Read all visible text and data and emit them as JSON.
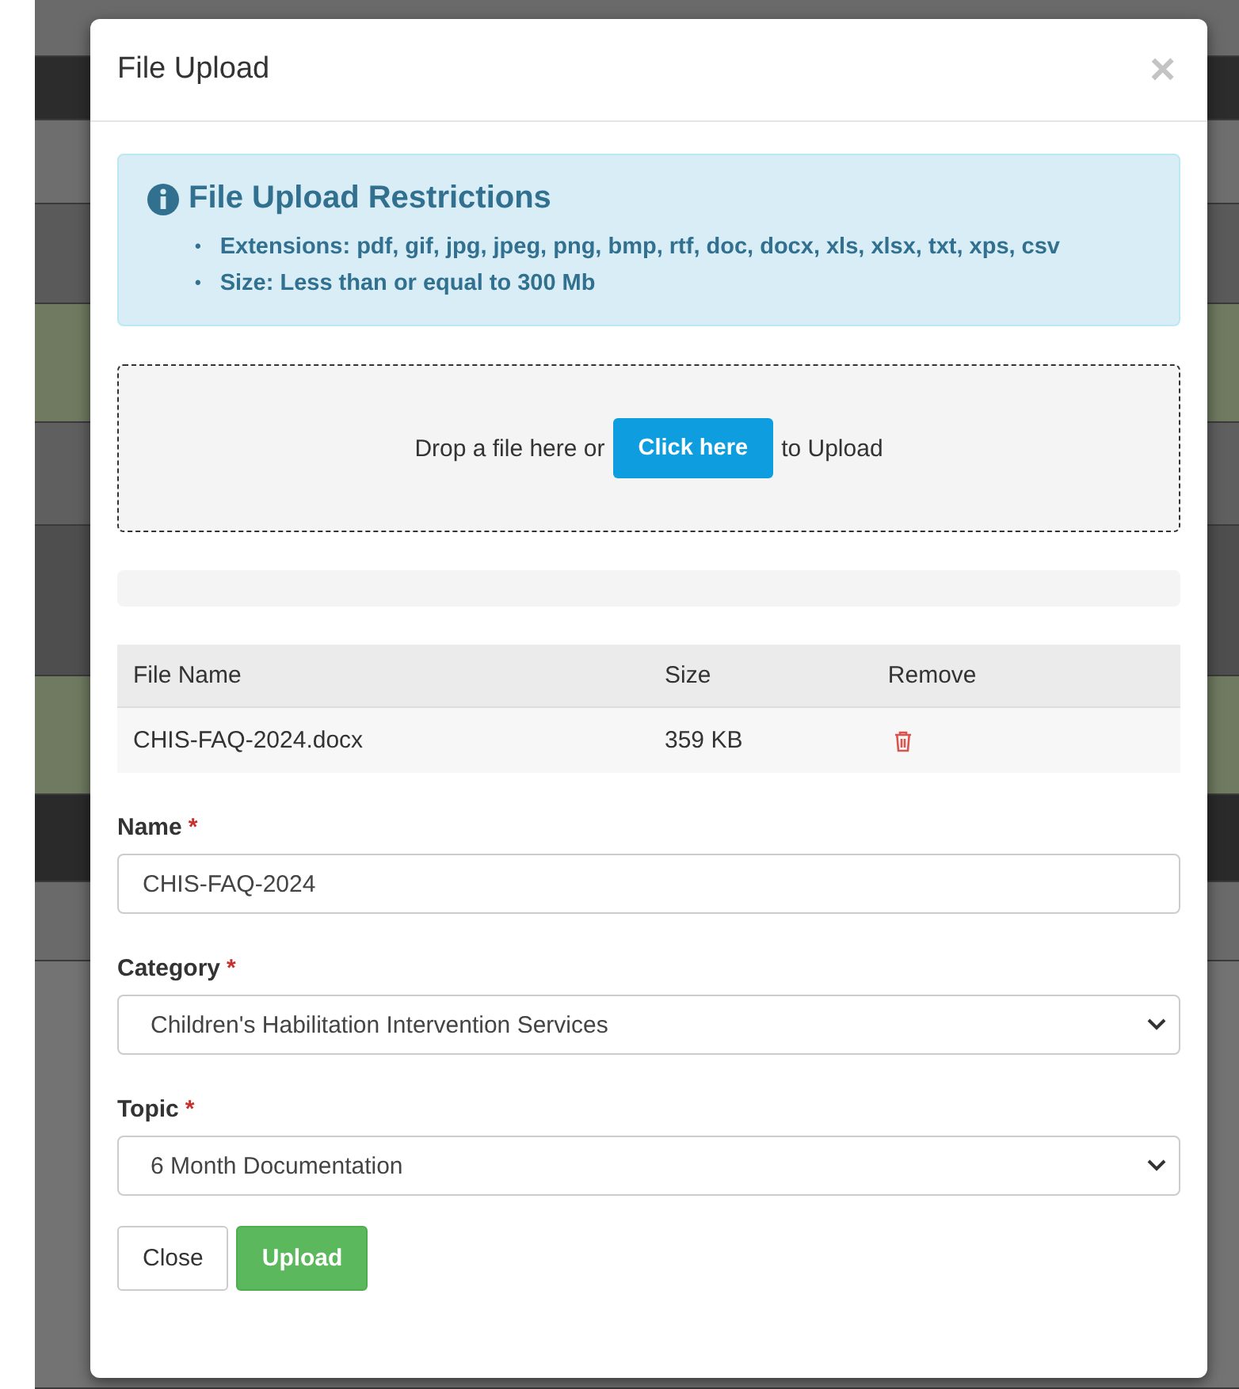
{
  "modal": {
    "title": "File Upload",
    "close_icon": "×"
  },
  "restrictions": {
    "title": "File Upload Restrictions",
    "bullet": "•",
    "items": [
      "Extensions: pdf, gif, jpg, jpeg, png, bmp, rtf, doc, docx, xls, xlsx, txt, xps, csv",
      "Size: Less than or equal to 300 Mb"
    ]
  },
  "dropzone": {
    "before": "Drop a file here or",
    "button": "Click here",
    "after": "to Upload"
  },
  "progress": {
    "level": 0
  },
  "table": {
    "columns": [
      "File Name",
      "Size",
      "Remove"
    ],
    "rows": [
      {
        "file_name": "CHIS-FAQ-2024.docx",
        "size": "359 KB"
      }
    ]
  },
  "fields": [
    {
      "kind": "input",
      "label": "Name",
      "required_mark": "*",
      "value": "CHIS-FAQ-2024"
    },
    {
      "kind": "select",
      "label": "Category",
      "required_mark": "*",
      "value": "Children's Habilitation Intervention Services"
    },
    {
      "kind": "select",
      "label": "Topic",
      "required_mark": "*",
      "value": "6 Month Documentation"
    }
  ],
  "buttons": [
    {
      "label": "Close",
      "kind": "default"
    },
    {
      "label": "Upload",
      "kind": "success"
    }
  ]
}
